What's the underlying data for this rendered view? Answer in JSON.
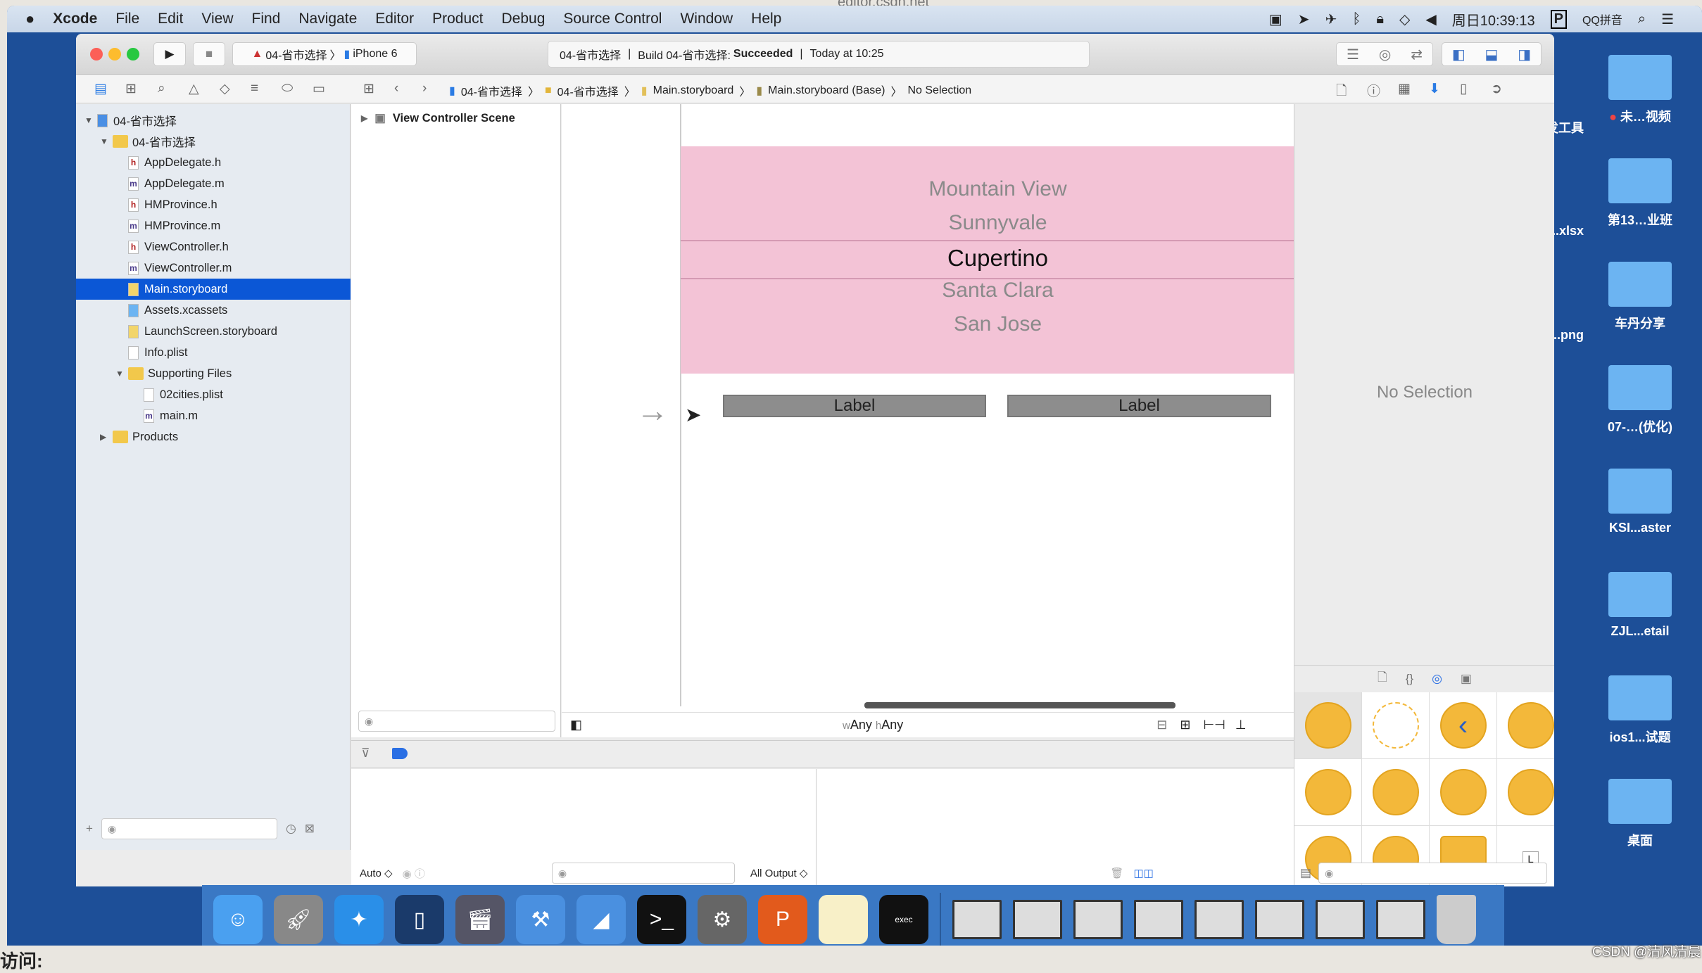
{
  "menubar": {
    "apple": "",
    "items": [
      "Xcode",
      "File",
      "Edit",
      "View",
      "Find",
      "Navigate",
      "Editor",
      "Product",
      "Debug",
      "Source Control",
      "Window",
      "Help"
    ],
    "clock": "周日10:39:13",
    "ime": "QQ拼音",
    "status_icons": [
      "screen-record-icon",
      "location-icon",
      "airplane-icon",
      "bluetooth-icon",
      "lock-icon",
      "wifi-icon",
      "volume-icon"
    ]
  },
  "browser_title": "editor.csdn.net",
  "toolbar": {
    "scheme": "04-省市选择",
    "device": "iPhone 6",
    "activity": {
      "project": "04-省市选择",
      "build_prefix": "Build 04-省市选择:",
      "build_status": "Succeeded",
      "time": "Today at 10:25"
    }
  },
  "breadcrumb": [
    "04-省市选择",
    "04-省市选择",
    "Main.storyboard",
    "Main.storyboard (Base)",
    "No Selection"
  ],
  "navigator": {
    "items": [
      {
        "label": "04-省市选择",
        "type": "project",
        "level": 0,
        "open": true
      },
      {
        "label": "04-省市选择",
        "type": "folder",
        "level": 1,
        "open": true
      },
      {
        "label": "AppDelegate.h",
        "type": "h",
        "level": 2
      },
      {
        "label": "AppDelegate.m",
        "type": "m",
        "level": 2
      },
      {
        "label": "HMProvince.h",
        "type": "h",
        "level": 2
      },
      {
        "label": "HMProvince.m",
        "type": "m",
        "level": 2
      },
      {
        "label": "ViewController.h",
        "type": "h",
        "level": 2
      },
      {
        "label": "ViewController.m",
        "type": "m",
        "level": 2
      },
      {
        "label": "Main.storyboard",
        "type": "storyboard",
        "level": 2,
        "selected": true
      },
      {
        "label": "Assets.xcassets",
        "type": "assets",
        "level": 2
      },
      {
        "label": "LaunchScreen.storyboard",
        "type": "storyboard",
        "level": 2
      },
      {
        "label": "Info.plist",
        "type": "plist",
        "level": 2
      },
      {
        "label": "Supporting Files",
        "type": "folder",
        "level": 2,
        "open": true
      },
      {
        "label": "02cities.plist",
        "type": "plist",
        "level": 3
      },
      {
        "label": "main.m",
        "type": "m",
        "level": 3
      },
      {
        "label": "Products",
        "type": "folder",
        "level": 1,
        "open": false
      }
    ]
  },
  "outline": {
    "scene": "View Controller Scene"
  },
  "canvas": {
    "picker_rows": [
      "Mountain View",
      "Sunnyvale",
      "Cupertino",
      "Santa Clara",
      "San Jose"
    ],
    "selected_row": "Cupertino",
    "labels": [
      "Label",
      "Label"
    ],
    "size_class": {
      "w": "w",
      "w_val": "Any",
      "h": "h",
      "h_val": "Any"
    },
    "picker_color": "#f3c3d6"
  },
  "debug": {
    "auto": "Auto ◇",
    "output": "All Output ◇"
  },
  "inspector": {
    "empty": "No Selection"
  },
  "library": {
    "items": [
      "view-controller-icon",
      "storyboard-reference-icon",
      "navigation-controller-icon",
      "table-view-controller-icon",
      "collection-view-controller-icon",
      "tab-bar-controller-icon",
      "split-view-controller-icon",
      "page-view-controller-icon",
      "glkit-view-controller-icon",
      "av-player-view-controller-icon",
      "object-icon",
      "label-icon"
    ],
    "label_glyph": "L"
  },
  "desktop": {
    "left_col": [
      "开发工具",
      "....xlsx",
      "....png"
    ],
    "right_col": [
      "未…视频",
      "第13…业班",
      "车丹分享",
      "07-…(优化)",
      "KSI...aster",
      "ZJL...etail",
      "ios1...试题",
      "桌面"
    ]
  },
  "dock": {
    "apps": [
      "finder-icon",
      "launchpad-icon",
      "safari-icon",
      "mouse-icon",
      "photo-booth-icon",
      "xcode-icon",
      "instruments-icon",
      "terminal-icon",
      "system-preferences-icon",
      "powerpoint-icon",
      "notes-icon",
      "console-icon"
    ],
    "windows": 8,
    "trash": "trash-icon"
  },
  "watermark": "CSDN @清风清晨",
  "page_fragment": "访问:"
}
